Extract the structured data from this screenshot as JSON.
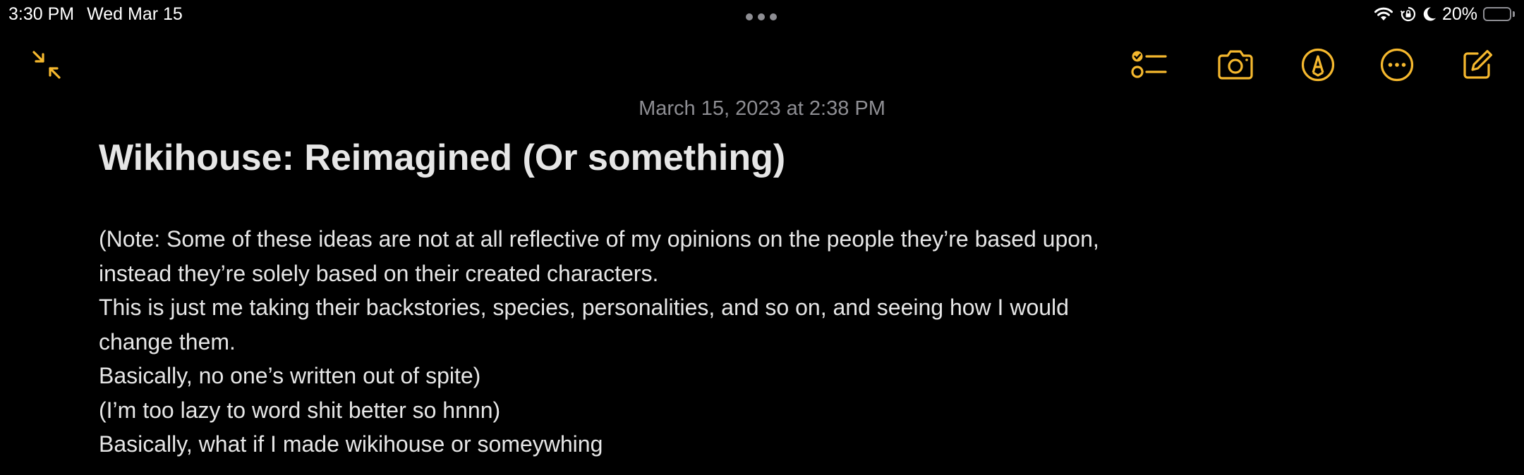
{
  "status_bar": {
    "time": "3:30 PM",
    "date": "Wed Mar 15",
    "battery_percent": "20%",
    "battery_level": 0.2,
    "icons": [
      "wifi-icon",
      "orientation-lock-icon",
      "moon-icon",
      "battery-icon"
    ]
  },
  "toolbar": {
    "accent_color": "#f5b82e",
    "buttons": [
      {
        "name": "collapse-button",
        "icon": "arrows-collapse-icon"
      },
      {
        "name": "checklist-button",
        "icon": "checklist-icon"
      },
      {
        "name": "camera-button",
        "icon": "camera-icon"
      },
      {
        "name": "markup-button",
        "icon": "pen-circle-icon"
      },
      {
        "name": "more-button",
        "icon": "ellipsis-circle-icon"
      },
      {
        "name": "compose-button",
        "icon": "compose-icon"
      }
    ]
  },
  "note": {
    "date": "March 15, 2023 at 2:38 PM",
    "title": "Wikihouse: Reimagined (Or something)",
    "lines": [
      "(Note: Some of these ideas are not at all reflective of my opinions on the people they’re based upon,",
      "instead they’re solely based on their created characters.",
      "This is just me taking their backstories, species, personalities, and so on, and seeing how I would",
      "change them.",
      "Basically, no one’s written out of spite)",
      "(I’m too lazy to word shit better so hnnn)",
      "Basically, what if I made wikihouse or someywhing"
    ]
  }
}
